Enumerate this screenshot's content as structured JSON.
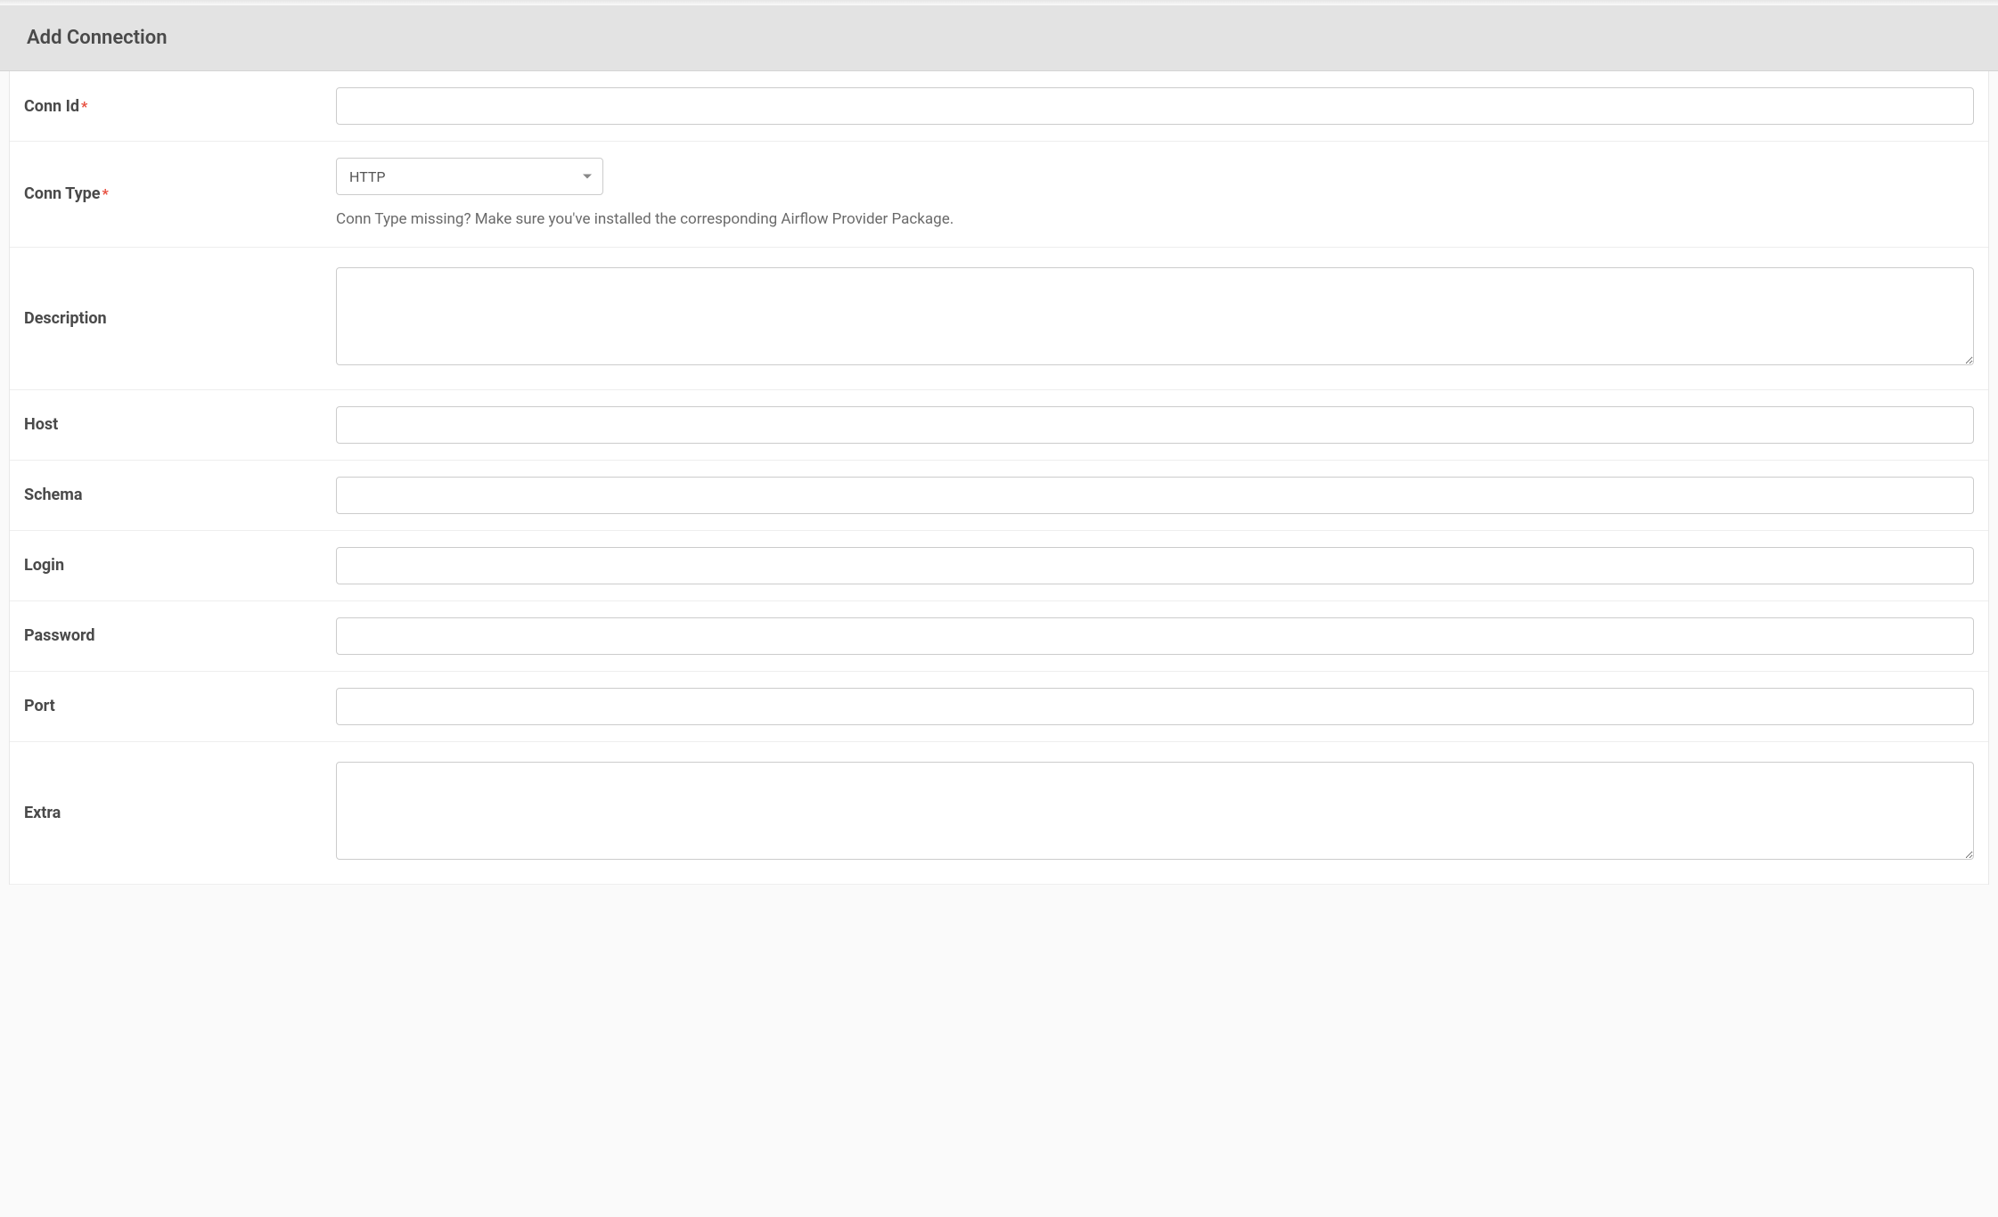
{
  "header": {
    "title": "Add Connection"
  },
  "form": {
    "conn_id": {
      "label": "Conn Id",
      "required": true,
      "value": ""
    },
    "conn_type": {
      "label": "Conn Type",
      "required": true,
      "selected": "HTTP",
      "hint": "Conn Type missing? Make sure you've installed the corresponding Airflow Provider Package."
    },
    "description": {
      "label": "Description",
      "value": ""
    },
    "host": {
      "label": "Host",
      "value": ""
    },
    "schema": {
      "label": "Schema",
      "value": ""
    },
    "login": {
      "label": "Login",
      "value": ""
    },
    "password": {
      "label": "Password",
      "value": ""
    },
    "port": {
      "label": "Port",
      "value": ""
    },
    "extra": {
      "label": "Extra",
      "value": ""
    },
    "required_mark": "*"
  }
}
